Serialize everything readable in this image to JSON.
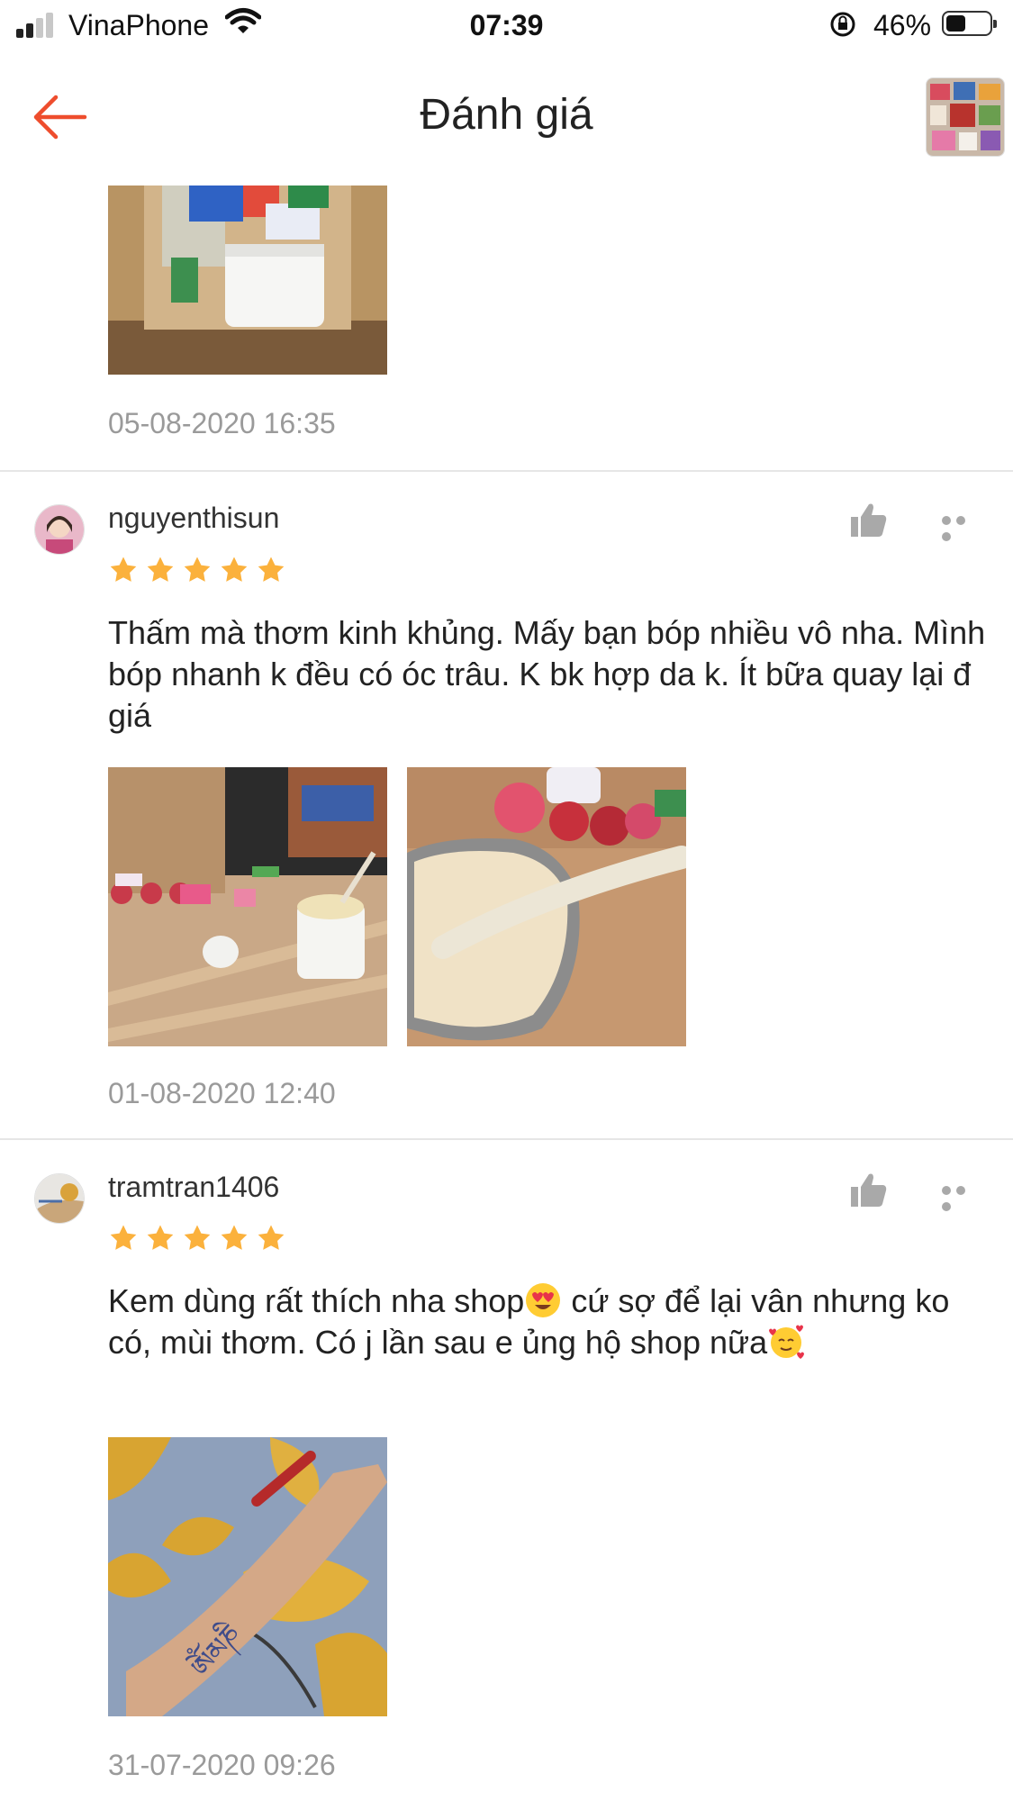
{
  "status_bar": {
    "carrier": "VinaPhone",
    "time": "07:39",
    "battery_percent": "46%",
    "battery_level": 0.46,
    "signal_bars": 2
  },
  "header": {
    "title": "Đánh giá",
    "back_icon": "arrow-left-icon",
    "accent_color": "#ee4d2d"
  },
  "reviews_top": {
    "date": "05-08-2020 16:35"
  },
  "reviews": [
    {
      "username": "nguyenthisun",
      "rating": 5,
      "text": "Thấm mà thơm kinh khủng. Mấy bạn bóp nhiều vô nha. Mình bóp nhanh k đều có óc trâu. K bk hợp da k. Ít bữa quay lại đ giá",
      "date": "01-08-2020 12:40"
    },
    {
      "username": "tramtran1406",
      "rating": 5,
      "text_part1": "Kem dùng rất thích nha shop",
      "text_part2": " cứ sợ  để lại vân nhưng ko có, mùi thơm. Có j lần sau e ủng hộ shop nữa",
      "date": "31-07-2020 09:26"
    }
  ],
  "colors": {
    "star": "#fbb13c",
    "date_text": "#9a9a9a",
    "icon_gray": "#a9a9a9"
  }
}
